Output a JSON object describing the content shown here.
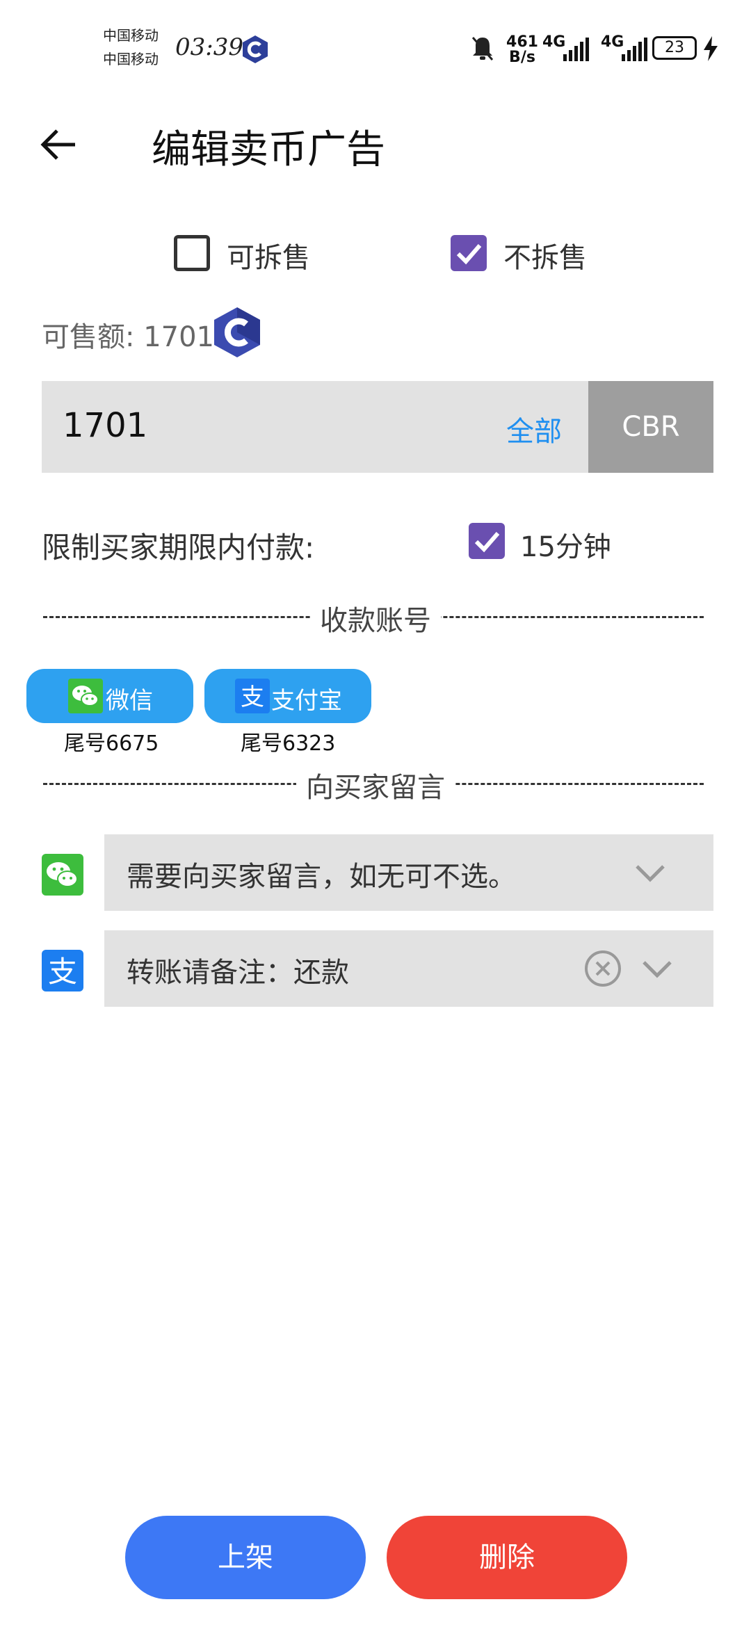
{
  "status_bar": {
    "carrier1": "中国移动",
    "carrier2": "中国移动",
    "time": "03:39",
    "net_speed_value": "461",
    "net_speed_unit": "B/s",
    "net1": "4G",
    "net2": "4G",
    "battery": "23"
  },
  "header": {
    "title": "编辑卖币广告"
  },
  "split_options": {
    "option1": {
      "label": "可拆售",
      "checked": false
    },
    "option2": {
      "label": "不拆售",
      "checked": true
    }
  },
  "available": {
    "label": "可售额: 1701"
  },
  "amount": {
    "value": "1701",
    "all_label": "全部",
    "unit": "CBR"
  },
  "payment_limit": {
    "label": "限制买家期限内付款:",
    "option": "15分钟",
    "checked": true
  },
  "accounts_section": {
    "title": "收款账号"
  },
  "accounts": [
    {
      "name": "微信",
      "tail": "尾号6675"
    },
    {
      "name": "支付宝",
      "tail": "尾号6323"
    }
  ],
  "message_section": {
    "title": "向买家留言"
  },
  "messages": [
    {
      "text": "需要向买家留言，如无可不选。"
    },
    {
      "text": "转账请备注：还款"
    }
  ],
  "buttons": {
    "list_label": "上架",
    "delete_label": "删除"
  },
  "colors": {
    "accent_purple": "#6a4fb0",
    "link_blue": "#1f8ff0",
    "chip_blue": "#2ea1f0",
    "list_button": "#3d78f5",
    "delete_button": "#f04438",
    "wechat_green": "#3dbd3d",
    "alipay_blue": "#1c7ef0"
  }
}
